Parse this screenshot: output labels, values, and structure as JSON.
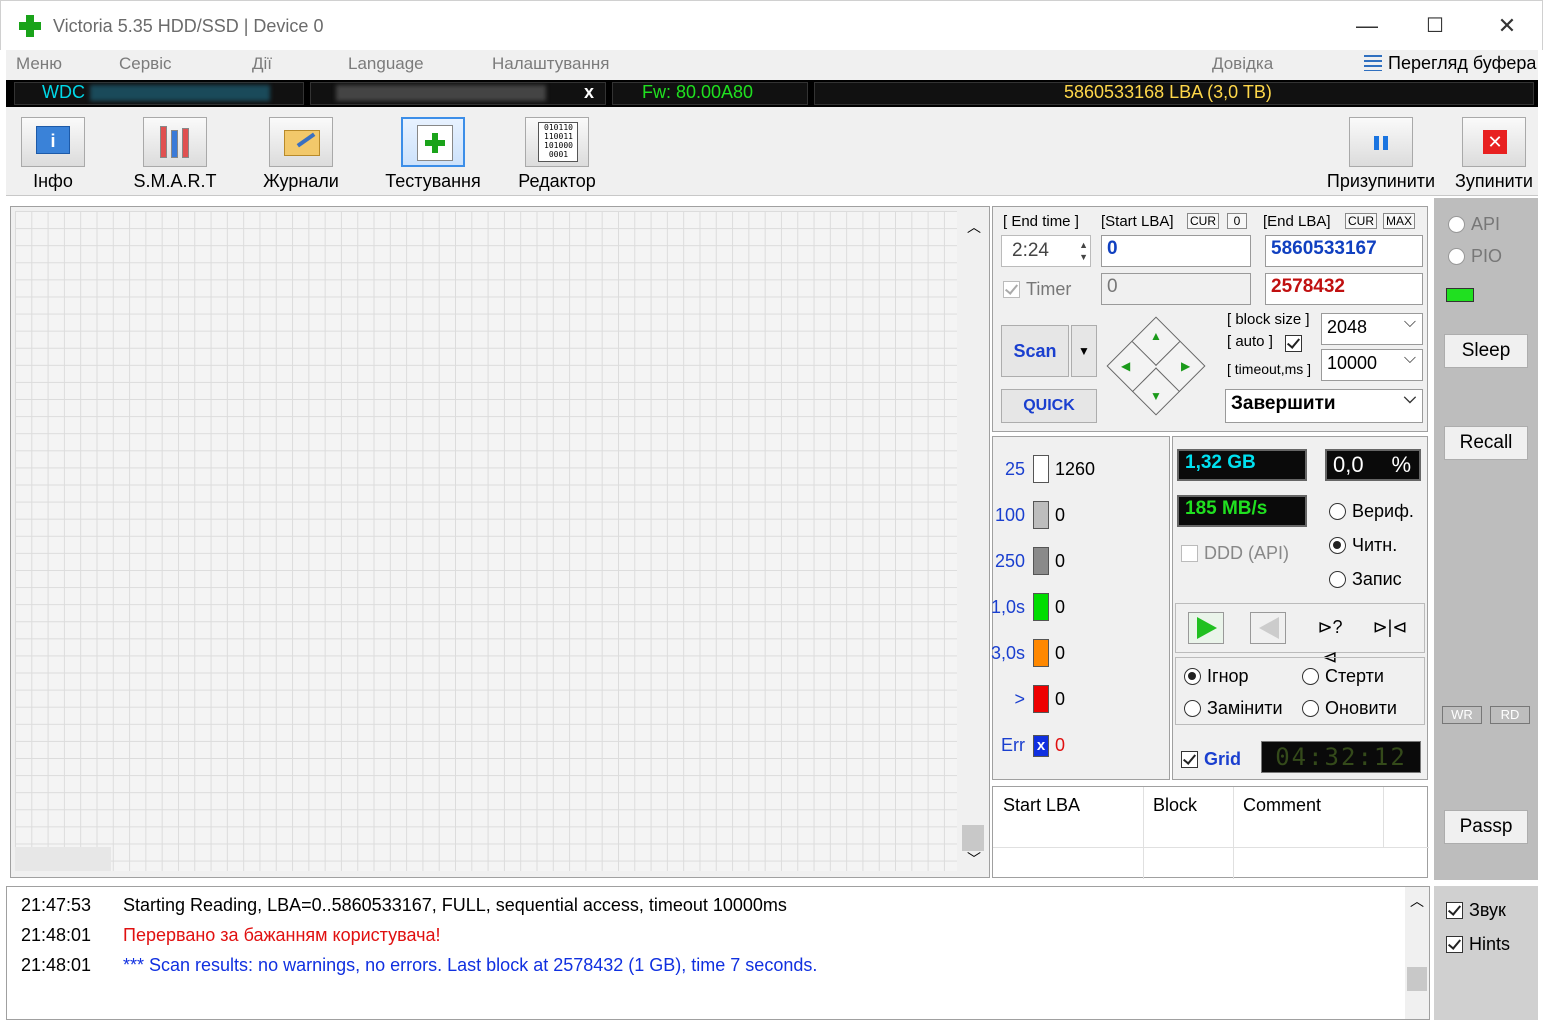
{
  "window": {
    "title": "Victoria 5.35 HDD/SSD | Device 0",
    "minimize_glyph": "—",
    "maximize_glyph": "☐",
    "close_glyph": "✕"
  },
  "menu": {
    "items": [
      "Меню",
      "Сервіс",
      "Дії",
      "Language",
      "Налаштування",
      "Довідка"
    ],
    "buffer_view": "Перегляд буфера"
  },
  "drive": {
    "vendor": "WDC",
    "close": "x",
    "firmware": "Fw: 80.00A80",
    "lba": "5860533168 LBA (3,0 TB)"
  },
  "toolbar": {
    "info": "Інфо",
    "smart": "S.M.A.R.T",
    "logs": "Журнали",
    "testing": "Тестування",
    "editor": "Редактор",
    "editor_icon_text": "010110\n110011\n101000\n0001",
    "pause": "Призупинити",
    "stop": "Зупинити"
  },
  "controls": {
    "end_time_label": "[ End time ]",
    "end_time_value": "2:24",
    "start_lba_label": "[Start LBA]",
    "cur": "CUR",
    "zero": "0",
    "end_lba_label": "[End LBA]",
    "max": "MAX",
    "start_lba_value": "0",
    "end_lba_value": "5860533167",
    "timer_label": "Timer",
    "timer_value": "0",
    "current_lba_value": "2578432",
    "block_size_label": "[ block size ]",
    "auto_label": "[ auto ]",
    "timeout_label": "[ timeout,ms ]",
    "block_size_value": "2048",
    "timeout_value": "10000",
    "scan_button": "Scan",
    "quick_button": "QUICK",
    "finish_action": "Завершити"
  },
  "stats": {
    "legend": [
      {
        "threshold": "25",
        "count": "1260",
        "color": "#ffffff"
      },
      {
        "threshold": "100",
        "count": "0",
        "color": "#bdbdbd"
      },
      {
        "threshold": "250",
        "count": "0",
        "color": "#8a8a8a"
      },
      {
        "threshold": "1,0s",
        "count": "0",
        "color": "#00dd00"
      },
      {
        "threshold": "3,0s",
        "count": "0",
        "color": "#ff8800"
      },
      {
        "threshold": ">",
        "count": "0",
        "color": "#ee0000"
      },
      {
        "threshold": "Err",
        "count": "0",
        "color": "#1030e0"
      }
    ],
    "size_done": "1,32 GB",
    "percent": "0,0",
    "percent_sign": "%",
    "speed": "185 MB/s",
    "ddd_api": "DDD (API)",
    "verify": "Вериф.",
    "read": "Читн.",
    "write": "Запис",
    "ignore": "Ігнор",
    "erase": "Стерти",
    "replace": "Замінити",
    "refresh": "Оновити",
    "grid_label": "Grid",
    "clock": "04:32:12",
    "err_mark": "x"
  },
  "table": {
    "columns": [
      "Start LBA",
      "Block",
      "Comment"
    ]
  },
  "side": {
    "api": "API",
    "pio": "PIO",
    "sleep": "Sleep",
    "recall": "Recall",
    "wr": "WR",
    "rd": "RD",
    "passp": "Passp",
    "sound": "Звук",
    "hints": "Hints"
  },
  "log": [
    {
      "time": "21:47:53",
      "text": "Starting Reading, LBA=0..5860533167, FULL, sequential access, timeout 10000ms",
      "color": "#000000"
    },
    {
      "time": "21:48:01",
      "text": "Перервано за бажанням користувача!",
      "color": "#e01010"
    },
    {
      "time": "21:48:01",
      "text": "*** Scan results: no warnings, no errors. Last block at 2578432 (1 GB), time 7 seconds.",
      "color": "#1030e0"
    }
  ]
}
